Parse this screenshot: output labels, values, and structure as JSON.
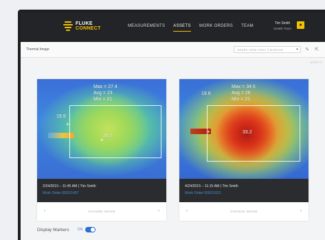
{
  "header": {
    "logo_line1": "FLUKE",
    "logo_line2": "CONNECT",
    "nav": [
      "MEASUREMENTS",
      "ASSETS",
      "WORK ORDERS",
      "TEAM"
    ],
    "active_nav": "ASSETS",
    "user_name": "Tim Smith",
    "user_team": "Seattle Team"
  },
  "subheader": {
    "title": "Thermal Image",
    "graph_view": "GRAPH VIEW: PAST 3 MONTHS",
    "assets_link": "ASSETS"
  },
  "cards": [
    {
      "max_label": "Max = 27.4",
      "avg_label": "Avg = 23",
      "min_label": "Min = 21",
      "side_temp": "19.9",
      "center_temp": "26.7",
      "date_line": "2/24/2015  –  11:45 AM  |  Tim Smith",
      "work_order": "Work Order 0002/1407",
      "change_label": "CHANGE IMAGE"
    },
    {
      "max_label": "Max = 34.5",
      "avg_label": "Avg = 26",
      "min_label": "Min = 21",
      "side_temp": "19.6",
      "center_temp": "33.2",
      "date_line": "4/24/2015  –  11:15 AM  |  Tim Smith",
      "work_order": "Work Order 0002/1021",
      "change_label": "CHANGE IMAGE"
    }
  ],
  "footer": {
    "display_markers_label": "Display Markers",
    "toggle_state": "ON"
  },
  "colors": {
    "accent": "#f2c200",
    "link": "#4a8fd6",
    "toggle": "#2d6fcf"
  }
}
